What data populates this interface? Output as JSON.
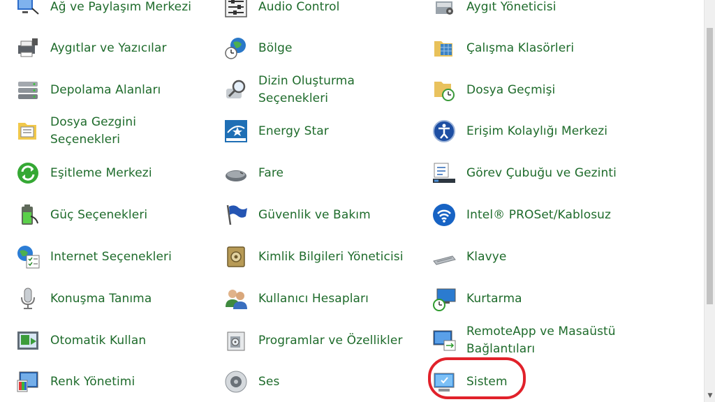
{
  "items": [
    [
      "Ağ ve Paylaşım Merkezi",
      "Audio Control",
      "Aygıt Yöneticisi"
    ],
    [
      "Aygıtlar ve Yazıcılar",
      "Bölge",
      "Çalışma Klasörleri"
    ],
    [
      "Depolama Alanları",
      "Dizin Oluşturma Seçenekleri",
      "Dosya Geçmişi"
    ],
    [
      "Dosya Gezgini Seçenekleri",
      "Energy Star",
      "Erişim Kolaylığı Merkezi"
    ],
    [
      "Eşitleme Merkezi",
      "Fare",
      "Görev Çubuğu ve Gezinti"
    ],
    [
      "Güç Seçenekleri",
      "Güvenlik ve Bakım",
      "Intel® PROSet/Kablosuz"
    ],
    [
      "Internet Seçenekleri",
      "Kimlik Bilgileri Yöneticisi",
      "Klavye"
    ],
    [
      "Konuşma Tanıma",
      "Kullanıcı Hesapları",
      "Kurtarma"
    ],
    [
      "Otomatik Kullan",
      "Programlar ve Özellikler",
      "RemoteApp ve Masaüstü Bağlantıları"
    ],
    [
      "Renk Yönetimi",
      "Ses",
      "Sistem"
    ]
  ],
  "colors": {
    "link": "#1e6b2b",
    "highlight": "#e1212a"
  }
}
